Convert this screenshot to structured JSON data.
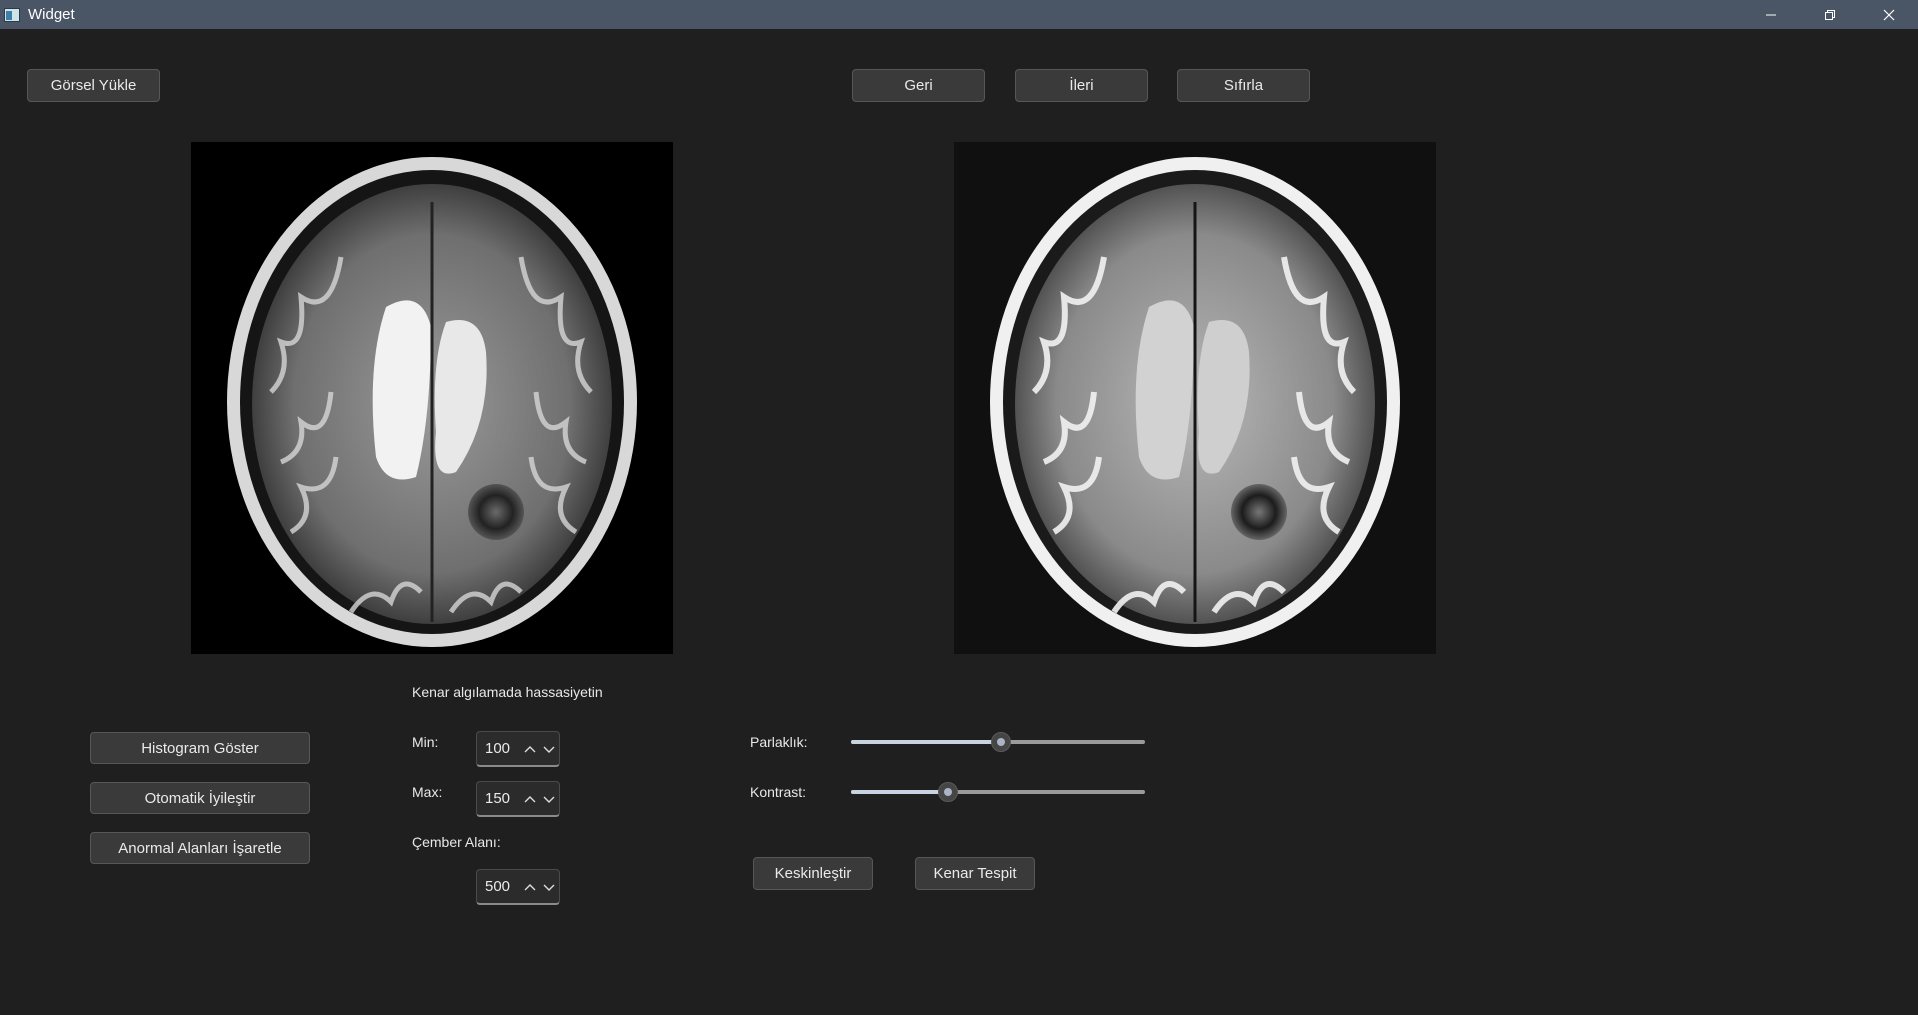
{
  "window": {
    "title": "Widget"
  },
  "toolbar": {
    "load_label": "Görsel Yükle",
    "back_label": "Geri",
    "forward_label": "İleri",
    "reset_label": "Sıfırla"
  },
  "left_buttons": {
    "histogram_label": "Histogram Göster",
    "auto_enhance_label": "Otomatik İyileştir",
    "mark_abnormal_label": "Anormal Alanları İşaretle"
  },
  "edge_sensitivity": {
    "heading": "Kenar algılamada hassasiyetin",
    "min_label": "Min:",
    "min_value": "100",
    "max_label": "Max:",
    "max_value": "150",
    "circle_label": "Çember Alanı:",
    "circle_value": "500"
  },
  "adjustments": {
    "brightness_label": "Parlaklık:",
    "brightness_level": 0.51,
    "contrast_label": "Kontrast:",
    "contrast_level": 0.33
  },
  "actions": {
    "sharpen_label": "Keskinleştir",
    "edge_detect_label": "Kenar Tespit"
  },
  "colors": {
    "titlebar": "#4a5566",
    "background": "#1f1f1f",
    "button": "#3a3a3a",
    "slider_accent": "#c9d3e0"
  }
}
